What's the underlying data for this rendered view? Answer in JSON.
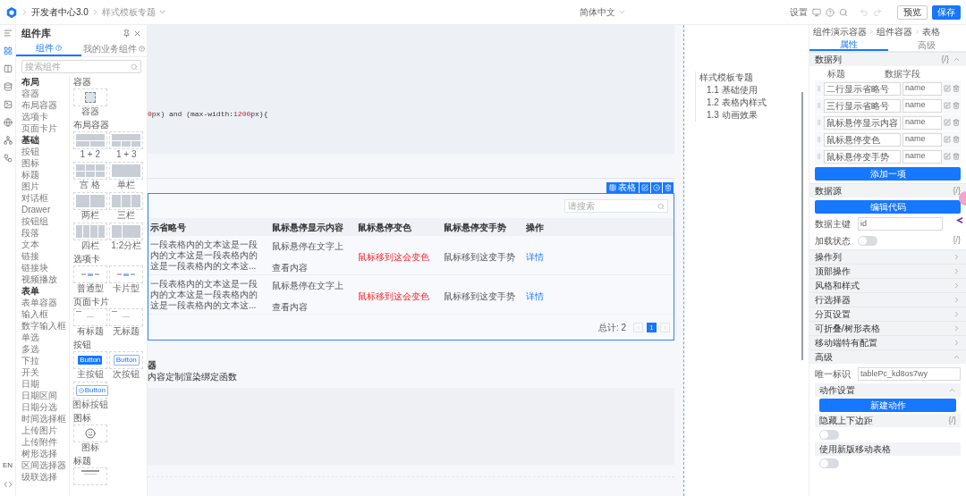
{
  "topbar": {
    "breadcrumb": [
      "开发者中心3.0",
      "样式模板专题"
    ],
    "language": "简体中文",
    "settings": "设置",
    "preview": "预览",
    "save": "保存"
  },
  "rail": {
    "language": "EN"
  },
  "component_panel": {
    "title": "组件库",
    "tabs": [
      {
        "label": "组件",
        "selected": true
      },
      {
        "label": "我的业务组件",
        "selected": false
      }
    ],
    "search": {
      "placeholder": "搜索组件"
    },
    "categories": [
      {
        "kind": "heading",
        "label": "布局"
      },
      {
        "kind": "item",
        "label": "容器"
      },
      {
        "kind": "item",
        "label": "布局容器"
      },
      {
        "kind": "item",
        "label": "选项卡"
      },
      {
        "kind": "item",
        "label": "页面卡片"
      },
      {
        "kind": "heading",
        "label": "基础"
      },
      {
        "kind": "item",
        "label": "按钮"
      },
      {
        "kind": "item",
        "label": "图标"
      },
      {
        "kind": "item",
        "label": "标题"
      },
      {
        "kind": "item",
        "label": "图片"
      },
      {
        "kind": "item",
        "label": "对话框"
      },
      {
        "kind": "item",
        "label": "Drawer"
      },
      {
        "kind": "item",
        "label": "按钮组"
      },
      {
        "kind": "item",
        "label": "段落"
      },
      {
        "kind": "item",
        "label": "文本"
      },
      {
        "kind": "item",
        "label": "链接"
      },
      {
        "kind": "item",
        "label": "链接块"
      },
      {
        "kind": "item",
        "label": "视频播放"
      },
      {
        "kind": "heading",
        "label": "表单"
      },
      {
        "kind": "item",
        "label": "表单容器"
      },
      {
        "kind": "item",
        "label": "输入框"
      },
      {
        "kind": "item",
        "label": "数字输入框"
      },
      {
        "kind": "item",
        "label": "单选"
      },
      {
        "kind": "item",
        "label": "多选"
      },
      {
        "kind": "item",
        "label": "下拉"
      },
      {
        "kind": "item",
        "label": "开关"
      },
      {
        "kind": "item",
        "label": "日期"
      },
      {
        "kind": "item",
        "label": "日期区间"
      },
      {
        "kind": "item",
        "label": "日期分选"
      },
      {
        "kind": "item",
        "label": "时间选择框"
      },
      {
        "kind": "item",
        "label": "上传图片"
      },
      {
        "kind": "item",
        "label": "上传附件"
      },
      {
        "kind": "item",
        "label": "树形选择"
      },
      {
        "kind": "item",
        "label": "区间选择器"
      },
      {
        "kind": "item",
        "label": "级联选择"
      }
    ],
    "gallery": [
      {
        "title": "容器",
        "tiles": [
          {
            "kind": "container",
            "label": "容器"
          }
        ]
      },
      {
        "title": "布局容器",
        "tiles": [
          {
            "kind": "rows2",
            "label": "1 + 2"
          },
          {
            "kind": "rows3",
            "label": "1 + 3"
          },
          {
            "kind": "grid",
            "label": "宫 格"
          },
          {
            "kind": "single",
            "label": "单栏"
          },
          {
            "kind": "two",
            "label": "两栏"
          },
          {
            "kind": "three",
            "label": "三栏"
          },
          {
            "kind": "four",
            "label": "四栏"
          },
          {
            "kind": "split",
            "label": "1:2分栏"
          }
        ]
      },
      {
        "title": "选项卡",
        "tiles": [
          {
            "kind": "tabs",
            "label": "普通型"
          },
          {
            "kind": "tabs",
            "label": "卡片型"
          }
        ]
      },
      {
        "title": "页面卡片",
        "tiles": [
          {
            "kind": "card",
            "label": "有标题"
          },
          {
            "kind": "card",
            "label": "无标题"
          }
        ]
      },
      {
        "title": "按钮",
        "tiles": [
          {
            "kind": "primary",
            "label": "主按钮",
            "preview": "Button"
          },
          {
            "kind": "secondary",
            "label": "次按钮",
            "preview": "Button"
          },
          {
            "kind": "iconbutton",
            "label": "图标按钮",
            "preview": "Button"
          }
        ]
      },
      {
        "title": "图标",
        "tiles": [
          {
            "kind": "icon",
            "label": "图标"
          }
        ]
      },
      {
        "title": "标题",
        "tiles": [
          {
            "kind": "heading"
          }
        ]
      }
    ]
  },
  "canvas": {
    "code": [
      {
        "kind": "number",
        "text": "0"
      },
      {
        "kind": "plain",
        "text": "px) and (max-width:"
      },
      {
        "kind": "number",
        "text": "1200"
      },
      {
        "kind": "plain",
        "text": "px){"
      }
    ],
    "table": {
      "tag": "表格",
      "search": {
        "placeholder": "请搜索"
      },
      "columns": [
        "示省略号",
        "鼠标悬停显示内容",
        "鼠标悬停变色",
        "鼠标悬停变手势",
        "操作"
      ],
      "rows": [
        {
          "cells": [
            {
              "kind": "lines",
              "lines": [
                "一段表格内的文本这是一段",
                "内的文本这是一段表格内的",
                "这是一段表格内的文本这..."
              ]
            },
            {
              "kind": "text",
              "text": "鼠标悬停在文字上查看内容"
            },
            {
              "kind": "danger",
              "text": "鼠标移到这会变色"
            },
            {
              "kind": "text",
              "text": "鼠标移到这变手势"
            },
            {
              "kind": "link",
              "text": "详情"
            }
          ]
        },
        {
          "cells": [
            {
              "kind": "lines",
              "lines": [
                "一段表格内的文本这是一段",
                "内的文本这是一段表格内的",
                "这是一段表格内的文本这..."
              ]
            },
            {
              "kind": "text",
              "text": "鼠标悬停在文字上查看内容"
            },
            {
              "kind": "danger",
              "text": "鼠标移到这会变色"
            },
            {
              "kind": "text",
              "text": "鼠标移到这变手势"
            },
            {
              "kind": "link",
              "text": "详情"
            }
          ]
        }
      ],
      "total": "总计: 2",
      "pages": [
        {
          "label": "1",
          "selected": true
        }
      ]
    },
    "notes": [
      {
        "kind": "heading",
        "text": "器"
      },
      {
        "kind": "text",
        "text": "内容定制渲染绑定函数"
      }
    ]
  },
  "toc": {
    "items": [
      {
        "label": "样式模板专题",
        "children": [
          {
            "label": "1.1 基础使用"
          },
          {
            "label": "1.2 表格内样式"
          },
          {
            "label": "1.3 动画效果"
          }
        ]
      }
    ]
  },
  "props": {
    "breadcrumb": [
      "组件演示容器",
      "组件容器",
      "表格"
    ],
    "tabs": [
      {
        "label": "属性",
        "selected": true
      },
      {
        "label": "高级",
        "selected": false
      }
    ],
    "sections": [
      {
        "kind": "columns",
        "title": "数据列",
        "code": "{/}",
        "expanded": true,
        "headers": [
          "标题",
          "数据字段"
        ],
        "rows": [
          {
            "title": "二行显示省略号",
            "field": "name"
          },
          {
            "title": "三行显示省略号",
            "field": "name"
          },
          {
            "title": "鼠标悬停显示内容",
            "field": "name"
          },
          {
            "title": "鼠标悬停变色",
            "field": "name"
          },
          {
            "title": "鼠标悬停变手势",
            "field": "name"
          }
        ],
        "button": "添加一项"
      },
      {
        "kind": "source",
        "title": "数据源",
        "code": "{/}",
        "button": "编辑代码",
        "key_label": "数据主键",
        "key_value": "id",
        "loading_label": "加载状态",
        "loading_on": false,
        "loading_code": "{/}"
      },
      {
        "kind": "plain",
        "title": "操作列",
        "expanded": false
      },
      {
        "kind": "plain",
        "title": "顶部操作",
        "expanded": false
      },
      {
        "kind": "plain",
        "title": "风格和样式",
        "expanded": false
      },
      {
        "kind": "plain",
        "title": "行选择器",
        "expanded": false
      },
      {
        "kind": "plain",
        "title": "分页设置",
        "expanded": false
      },
      {
        "kind": "plain",
        "title": "可折叠/树形表格",
        "expanded": false
      },
      {
        "kind": "plain",
        "title": "移动端特有配置",
        "expanded": false
      },
      {
        "kind": "advanced",
        "title": "高级",
        "expanded": true,
        "id_label": "唯一标识",
        "id_value": "tablePc_kd8os7wy",
        "action": {
          "title": "动作设置",
          "expanded": true,
          "button": "新建动作"
        },
        "toggles": [
          {
            "label": "隐藏上下边距",
            "code": "{/}",
            "on": false
          },
          {
            "label": "使用新版移动表格",
            "on": false
          }
        ]
      }
    ]
  }
}
